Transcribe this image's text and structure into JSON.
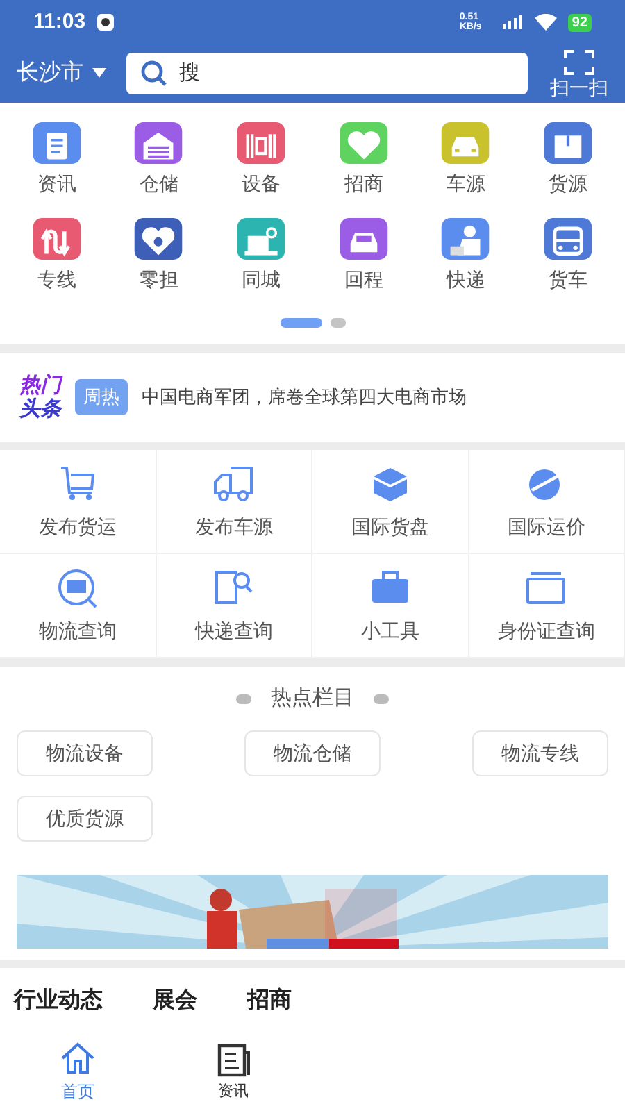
{
  "status_bar": {
    "time": "11:03",
    "speed": "0.51 KB/s",
    "battery": "92"
  },
  "header": {
    "city": "长沙市",
    "search": {
      "placeholder": "搜"
    },
    "scan": "扫一扫"
  },
  "categories": [
    {
      "label": "资讯",
      "color": "#5b8def"
    },
    {
      "label": "仓储",
      "color": "#9b5de5"
    },
    {
      "label": "设备",
      "color": "#e85a71"
    },
    {
      "label": "招商",
      "color": "#5fd35f"
    },
    {
      "label": "车源",
      "color": "#c9c22c"
    },
    {
      "label": "货源",
      "color": "#4f79d6"
    },
    {
      "label": "专线",
      "color": "#e85a71"
    },
    {
      "label": "零担",
      "color": "#3d5fb8"
    },
    {
      "label": "同城",
      "color": "#2cb5b0"
    },
    {
      "label": "回程",
      "color": "#9b5de5"
    },
    {
      "label": "快递",
      "color": "#5b8def"
    },
    {
      "label": "货车",
      "color": "#4f79d6"
    }
  ],
  "pager": [
    {
      "selected": true
    },
    {
      "selected": false
    }
  ],
  "headline": {
    "logo_top": "热门",
    "logo_bottom": "头条",
    "tag": "周热",
    "text": "中国电商军团，席卷全球第四大电商市场"
  },
  "tools": [
    {
      "label": "发布货运"
    },
    {
      "label": "发布车源"
    },
    {
      "label": "国际货盘"
    },
    {
      "label": "国际运价"
    },
    {
      "label": "物流查询"
    },
    {
      "label": "快递查询"
    },
    {
      "label": "小工具"
    },
    {
      "label": "身份证查询"
    }
  ],
  "hot_columns": {
    "title": "热点栏目",
    "items": [
      "物流设备",
      "物流仓储",
      "物流专线",
      "优质货源"
    ]
  },
  "banner": {
    "kind": "picture"
  },
  "news_tabs": [
    "行业动态",
    "展会",
    "招商"
  ],
  "bottom_nav": [
    {
      "label": "首页",
      "selected": true
    },
    {
      "label": "资讯",
      "selected": false
    }
  ]
}
